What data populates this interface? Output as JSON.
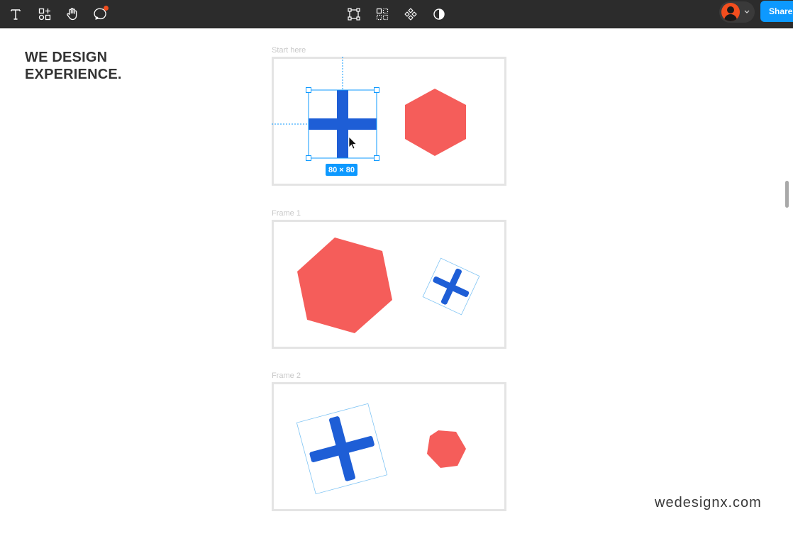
{
  "toolbar": {
    "left_tools": [
      {
        "icon": "text-icon"
      },
      {
        "icon": "resources-icon"
      },
      {
        "icon": "hand-icon"
      },
      {
        "icon": "comment-icon",
        "has_notification": true
      }
    ],
    "center_tools": [
      {
        "icon": "frame-selection-icon"
      },
      {
        "icon": "grid-layout-icon"
      },
      {
        "icon": "component-icon"
      },
      {
        "icon": "contrast-icon"
      }
    ],
    "share_label": "Share",
    "accent_color": "#0d99ff",
    "notification_color": "#f24e1e"
  },
  "canvas": {
    "headline_line1": "WE DESIGN",
    "headline_line2": "EXPERIENCE.",
    "frames": [
      {
        "label": "Start here",
        "selection_size": "80 × 80"
      },
      {
        "label": "Frame 1"
      },
      {
        "label": "Frame 2"
      }
    ],
    "watermark": "wedesignx.com",
    "shape_colors": {
      "cross": "#1e5ed6",
      "hexagon": "#f55d5a",
      "selection": "#0d99ff"
    }
  }
}
